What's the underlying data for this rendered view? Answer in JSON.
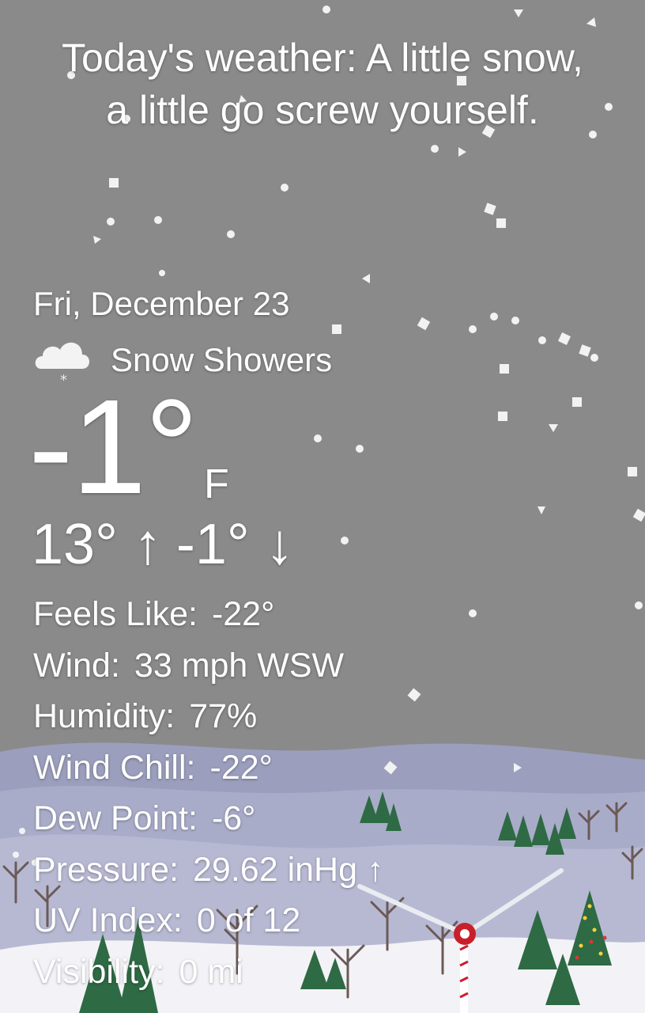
{
  "headline": "Today's weather: A little snow, a little go screw yourself.",
  "date": "Fri, December 23",
  "condition": {
    "icon": "snow-cloud-icon",
    "label": "Snow Showers"
  },
  "temperature": {
    "value": "-1°",
    "unit": "F"
  },
  "high": "13° ↑",
  "low": "-1° ↓",
  "stats": [
    {
      "label": "Feels Like:",
      "value": "-22°"
    },
    {
      "label": "Wind:",
      "value": "33 mph WSW"
    },
    {
      "label": "Humidity:",
      "value": "77%"
    },
    {
      "label": "Wind Chill:",
      "value": "-22°"
    },
    {
      "label": "Dew Point:",
      "value": "-6°"
    },
    {
      "label": "Pressure:",
      "value": "29.62 inHg ↑"
    },
    {
      "label": "UV Index:",
      "value": "0 of 12"
    },
    {
      "label": "Visibility:",
      "value": "0 mi"
    }
  ],
  "colors": {
    "sky": "#8a8a8a",
    "hills": "#a3a7c4",
    "snow": "#f4f4f7",
    "tree": "#2f6a43",
    "accent_red": "#c8202b"
  }
}
